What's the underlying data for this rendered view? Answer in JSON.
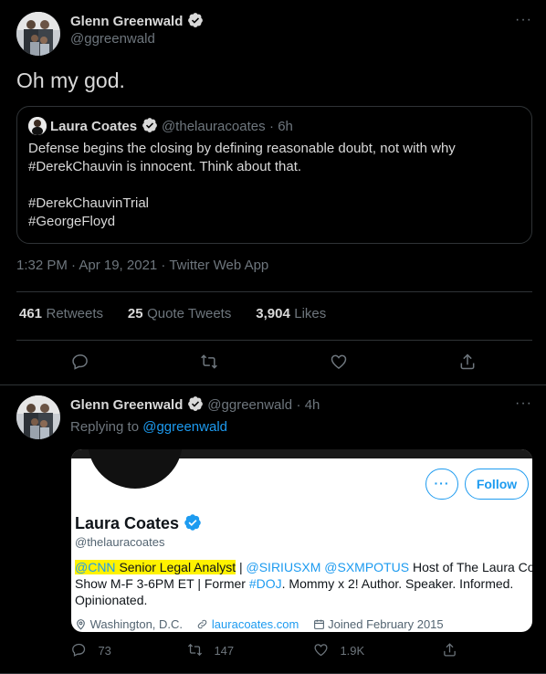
{
  "tweet": {
    "author_name": "Glenn Greenwald",
    "author_handle": "@ggreenwald",
    "more": "···",
    "text": "Oh my god.",
    "quote": {
      "author_name": "Laura Coates",
      "author_handle": "@thelauracoates",
      "time": "· 6h",
      "line1": "Defense begins the closing by defining reasonable doubt, not with why",
      "line2": "#DerekChauvin is innocent. Think about that.",
      "line3": "#DerekChauvinTrial",
      "line4": "#GeorgeFloyd"
    },
    "timestamp": "1:32 PM · Apr 19, 2021 · Twitter Web App",
    "stats": {
      "retweets_num": "461",
      "retweets_label": "Retweets",
      "quotes_num": "25",
      "quotes_label": "Quote Tweets",
      "likes_num": "3,904",
      "likes_label": "Likes"
    }
  },
  "reply": {
    "author_name": "Glenn Greenwald",
    "author_handle": "@ggreenwald",
    "time": "· 4h",
    "more": "···",
    "replying_prefix": "Replying to",
    "replying_to": "@ggreenwald",
    "card": {
      "more": "···",
      "follow_label": "Follow",
      "name": "Laura Coates",
      "handle": "@thelauracoates",
      "bio": {
        "cnn": "@CNN",
        "title": "Senior Legal Analyst",
        "sep": " | ",
        "sirius": "@SIRIUSXM",
        "sxm": "@SXMPOTUS",
        "rest1": " Host of The Laura Coates",
        "line2a": "Show M-F 3-6PM ET | Former ",
        "doj": "#DOJ",
        "line2b": ". Mommy x 2! Author. Speaker. Informed.",
        "line3": "Opinionated."
      },
      "location": "Washington, D.C.",
      "website": "lauracoates.com",
      "joined": "Joined February 2015"
    },
    "actions": {
      "replies": "73",
      "retweets": "147",
      "likes": "1.9K"
    }
  }
}
